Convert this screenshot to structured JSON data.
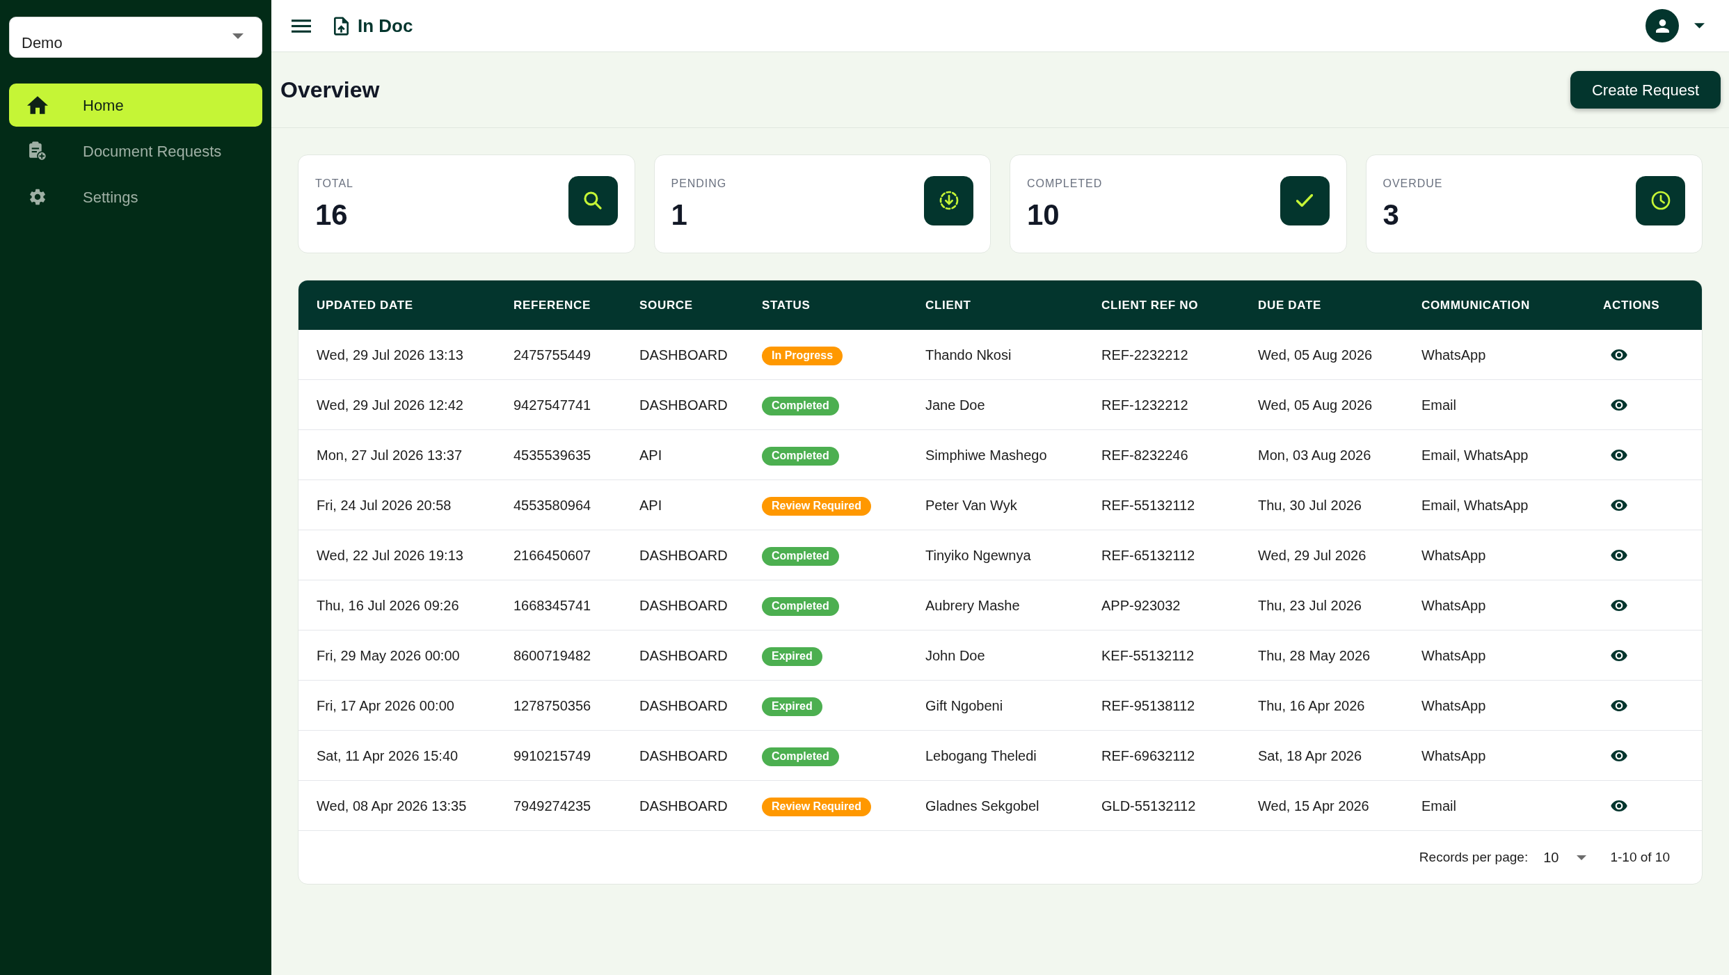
{
  "sidebar": {
    "workspace_select": {
      "value": "Demo"
    },
    "items": [
      {
        "label": "Home",
        "selected": true
      },
      {
        "label": "Document Requests",
        "selected": false
      },
      {
        "label": "Settings",
        "selected": false
      }
    ]
  },
  "header": {
    "app_title": "In Doc"
  },
  "page": {
    "title": "Overview",
    "primary_action": "Create Request"
  },
  "stats": [
    {
      "label": "TOTAL",
      "value": "16"
    },
    {
      "label": "PENDING",
      "value": "1"
    },
    {
      "label": "COMPLETED",
      "value": "10"
    },
    {
      "label": "OVERDUE",
      "value": "3"
    }
  ],
  "table": {
    "columns": [
      {
        "label": "UPDATED DATE"
      },
      {
        "label": "REFERENCE"
      },
      {
        "label": "SOURCE"
      },
      {
        "label": "STATUS"
      },
      {
        "label": "CLIENT"
      },
      {
        "label": "CLIENT REF NO"
      },
      {
        "label": "DUE DATE"
      },
      {
        "label": "COMMUNICATION"
      },
      {
        "label": "ACTIONS"
      }
    ],
    "rows": [
      {
        "updated_date": "Wed, 29 Jul 2026 13:13",
        "reference": "2475755449",
        "source": "DASHBOARD",
        "status": {
          "label": "In Progress",
          "color": "#ff9800"
        },
        "client": "Thando Nkosi",
        "client_ref_no": "REF-2232212",
        "due_date": "Wed, 05 Aug 2026",
        "communication": "WhatsApp"
      },
      {
        "updated_date": "Wed, 29 Jul 2026 12:42",
        "reference": "9427547741",
        "source": "DASHBOARD",
        "status": {
          "label": "Completed",
          "color": "#4caf50"
        },
        "client": "Jane Doe",
        "client_ref_no": "REF-1232212",
        "due_date": "Wed, 05 Aug 2026",
        "communication": "Email"
      },
      {
        "updated_date": "Mon, 27 Jul 2026 13:37",
        "reference": "4535539635",
        "source": "API",
        "status": {
          "label": "Completed",
          "color": "#4caf50"
        },
        "client": "Simphiwe Mashego",
        "client_ref_no": "REF-8232246",
        "due_date": "Mon, 03 Aug 2026",
        "communication": "Email, WhatsApp"
      },
      {
        "updated_date": "Fri, 24 Jul 2026 20:58",
        "reference": "4553580964",
        "source": "API",
        "status": {
          "label": "Review Required",
          "color": "#ff9800"
        },
        "client": "Peter Van Wyk",
        "client_ref_no": "REF-55132112",
        "due_date": "Thu, 30 Jul 2026",
        "communication": "Email, WhatsApp"
      },
      {
        "updated_date": "Wed, 22 Jul 2026 19:13",
        "reference": "2166450607",
        "source": "DASHBOARD",
        "status": {
          "label": "Completed",
          "color": "#4caf50"
        },
        "client": "Tinyiko Ngewnya",
        "client_ref_no": "REF-65132112",
        "due_date": "Wed, 29 Jul 2026",
        "communication": "WhatsApp"
      },
      {
        "updated_date": "Thu, 16 Jul 2026 09:26",
        "reference": "1668345741",
        "source": "DASHBOARD",
        "status": {
          "label": "Completed",
          "color": "#4caf50"
        },
        "client": "Aubrery Mashe",
        "client_ref_no": "APP-923032",
        "due_date": "Thu, 23 Jul 2026",
        "communication": "WhatsApp"
      },
      {
        "updated_date": "Fri, 29 May 2026 00:00",
        "reference": "8600719482",
        "source": "DASHBOARD",
        "status": {
          "label": "Expired",
          "color": "#4caf50"
        },
        "client": "John Doe",
        "client_ref_no": "KEF-55132112",
        "due_date": "Thu, 28 May 2026",
        "communication": "WhatsApp"
      },
      {
        "updated_date": "Fri, 17 Apr 2026 00:00",
        "reference": "1278750356",
        "source": "DASHBOARD",
        "status": {
          "label": "Expired",
          "color": "#4caf50"
        },
        "client": "Gift Ngobeni",
        "client_ref_no": "REF-95138112",
        "due_date": "Thu, 16 Apr 2026",
        "communication": "WhatsApp"
      },
      {
        "updated_date": "Sat, 11 Apr 2026 15:40",
        "reference": "9910215749",
        "source": "DASHBOARD",
        "status": {
          "label": "Completed",
          "color": "#4caf50"
        },
        "client": "Lebogang Theledi",
        "client_ref_no": "REF-69632112",
        "due_date": "Sat, 18 Apr 2026",
        "communication": "WhatsApp"
      },
      {
        "updated_date": "Wed, 08 Apr 2026 13:35",
        "reference": "7949274235",
        "source": "DASHBOARD",
        "status": {
          "label": "Review Required",
          "color": "#ff9800"
        },
        "client": "Gladnes Sekgobel",
        "client_ref_no": "GLD-55132112",
        "due_date": "Wed, 15 Apr 2026",
        "communication": "Email"
      }
    ],
    "pagination": {
      "records_per_page_label": "Records per page:",
      "page_size": "10",
      "range": "1-10 of 10"
    }
  }
}
